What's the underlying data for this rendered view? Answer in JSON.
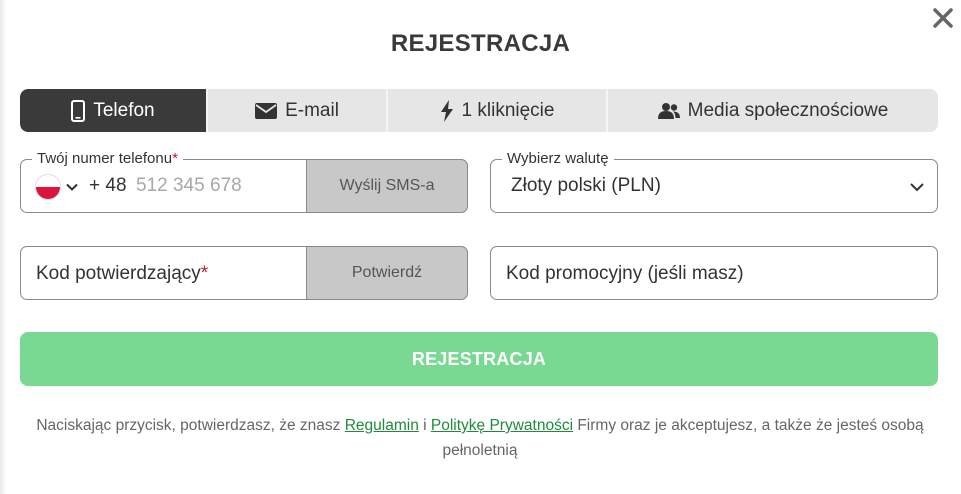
{
  "modal": {
    "title": "REJESTRACJA"
  },
  "tabs": [
    {
      "label": "Telefon",
      "icon": "phone-icon",
      "active": true
    },
    {
      "label": "E-mail",
      "icon": "envelope-icon",
      "active": false
    },
    {
      "label": "1 kliknięcie",
      "icon": "lightning-icon",
      "active": false
    },
    {
      "label": "Media społecznościowe",
      "icon": "users-icon",
      "active": false
    }
  ],
  "phone": {
    "label": "Twój numer telefonu",
    "required_mark": "*",
    "country_flag": "poland-flag-icon",
    "dial_code": "+ 48",
    "placeholder": "512 345 678",
    "send_button": "Wyślij SMS-a"
  },
  "currency": {
    "label": "Wybierz walutę",
    "value": "Złoty polski (PLN)"
  },
  "confirmation": {
    "label": "Kod potwierdzający",
    "required_mark": "*",
    "confirm_button": "Potwierdź"
  },
  "promo": {
    "label": "Kod promocyjny (jeśli masz)"
  },
  "register_button": "REJESTRACJA",
  "legal": {
    "text_before": "Naciskając przycisk, potwierdzasz, że znasz ",
    "terms_link": "Regulamin",
    "text_between": " i ",
    "privacy_link": "Politykę Prywatności",
    "text_after": " Firmy oraz je akceptujesz, a także że jesteś osobą pełnoletnią"
  },
  "colors": {
    "active_tab": "#3a3a3a",
    "register_button": "#79d892",
    "link": "#1f8a3c",
    "required": "#c0202a"
  }
}
